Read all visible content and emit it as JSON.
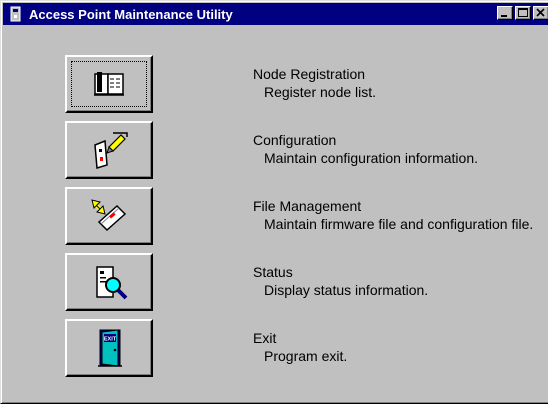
{
  "window": {
    "title": "Access Point Maintenance Utility",
    "title_bar_color": "#000080",
    "app_icon": "app-icon",
    "controls": [
      "minimize-icon",
      "maximize-icon",
      "close-icon"
    ]
  },
  "items": [
    {
      "title": "Node Registration",
      "description": "Register node list.",
      "icon": "book-icon"
    },
    {
      "title": "Configuration",
      "description": "Maintain configuration information.",
      "icon": "configuration-icon"
    },
    {
      "title": "File Management",
      "description": "Maintain firmware file and configuration file.",
      "icon": "file-transfer-icon"
    },
    {
      "title": "Status",
      "description": "Display status information.",
      "icon": "magnifier-icon"
    },
    {
      "title": "Exit",
      "description": "Program exit.",
      "exit_label": "EXIT",
      "icon": "exit-door-icon"
    }
  ]
}
